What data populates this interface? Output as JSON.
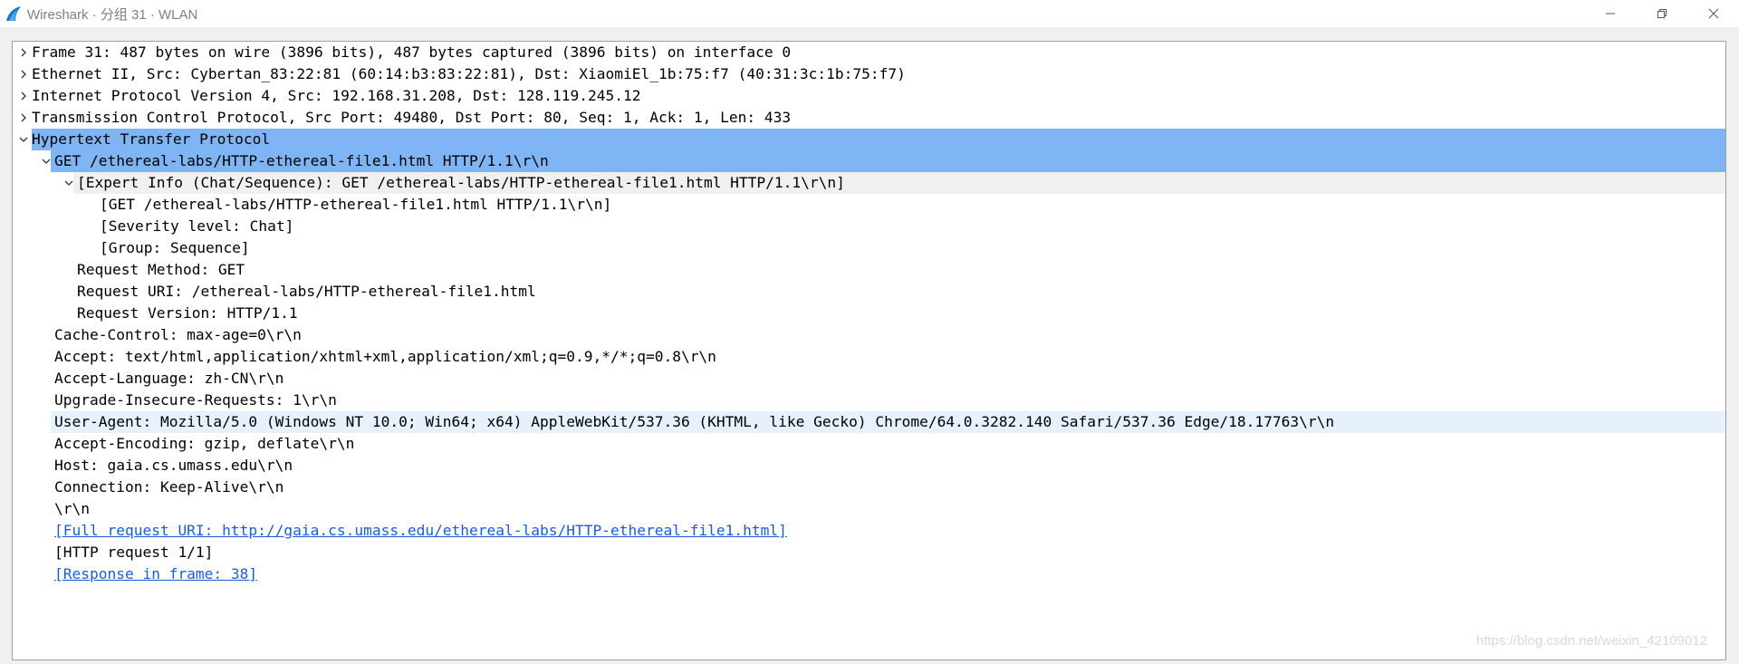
{
  "window": {
    "title": "Wireshark · 分组 31 · WLAN",
    "icon": "wireshark-fin-icon",
    "controls": [
      "minimize-icon",
      "restore-icon",
      "close-icon"
    ]
  },
  "tree": {
    "rows": [
      {
        "text": "Frame 31: 487 bytes on wire (3896 bits), 487 bytes captured (3896 bits) on interface 0",
        "expander": "collapsed",
        "state": ""
      },
      {
        "text": "Ethernet II, Src: Cybertan_83:22:81 (60:14:b3:83:22:81), Dst: XiaomiEl_1b:75:f7 (40:31:3c:1b:75:f7)",
        "expander": "collapsed",
        "state": ""
      },
      {
        "text": "Internet Protocol Version 4, Src: 192.168.31.208, Dst: 128.119.245.12",
        "expander": "collapsed",
        "state": ""
      },
      {
        "text": "Transmission Control Protocol, Src Port: 49480, Dst Port: 80, Seq: 1, Ack: 1, Len: 433",
        "expander": "collapsed",
        "state": ""
      },
      {
        "text": "Hypertext Transfer Protocol",
        "expander": "expanded",
        "state": "selected"
      },
      {
        "text": "GET /ethereal-labs/HTTP-ethereal-file1.html HTTP/1.1\\r\\n",
        "expander": "expanded",
        "state": "selected"
      },
      {
        "text": "[Expert Info (Chat/Sequence): GET /ethereal-labs/HTTP-ethereal-file1.html HTTP/1.1\\r\\n]",
        "expander": "expanded",
        "state": "related"
      },
      {
        "text": "[GET /ethereal-labs/HTTP-ethereal-file1.html HTTP/1.1\\r\\n]",
        "expander": "none",
        "state": ""
      },
      {
        "text": "[Severity level: Chat]",
        "expander": "none",
        "state": ""
      },
      {
        "text": "[Group: Sequence]",
        "expander": "none",
        "state": ""
      },
      {
        "text": "Request Method: GET",
        "expander": "none",
        "state": ""
      },
      {
        "text": "Request URI: /ethereal-labs/HTTP-ethereal-file1.html",
        "expander": "none",
        "state": ""
      },
      {
        "text": "Request Version: HTTP/1.1",
        "expander": "none",
        "state": ""
      },
      {
        "text": "Cache-Control: max-age=0\\r\\n",
        "expander": "none",
        "state": ""
      },
      {
        "text": "Accept: text/html,application/xhtml+xml,application/xml;q=0.9,*/*;q=0.8\\r\\n",
        "expander": "none",
        "state": ""
      },
      {
        "text": "Accept-Language: zh-CN\\r\\n",
        "expander": "none",
        "state": ""
      },
      {
        "text": "Upgrade-Insecure-Requests: 1\\r\\n",
        "expander": "none",
        "state": ""
      },
      {
        "text": "User-Agent: Mozilla/5.0 (Windows NT 10.0; Win64; x64) AppleWebKit/537.36 (KHTML, like Gecko) Chrome/64.0.3282.140 Safari/537.36 Edge/18.17763\\r\\n",
        "expander": "none",
        "state": "hover"
      },
      {
        "text": "Accept-Encoding: gzip, deflate\\r\\n",
        "expander": "none",
        "state": ""
      },
      {
        "text": "Host: gaia.cs.umass.edu\\r\\n",
        "expander": "none",
        "state": ""
      },
      {
        "text": "Connection: Keep-Alive\\r\\n",
        "expander": "none",
        "state": ""
      },
      {
        "text": "\\r\\n",
        "expander": "none",
        "state": ""
      },
      {
        "text": "[Full request URI: http://gaia.cs.umass.edu/ethereal-labs/HTTP-ethereal-file1.html]",
        "expander": "none",
        "state": "",
        "link": true
      },
      {
        "text": "[HTTP request 1/1]",
        "expander": "none",
        "state": ""
      },
      {
        "text": "[Response in frame: 38]",
        "expander": "none",
        "state": "",
        "link": true
      }
    ]
  },
  "watermark": "https://blog.csdn.net/weixin_42109012",
  "colors": {
    "selected": "#80b5f5",
    "related": "#f0f0f0",
    "hover": "#e6f1fc",
    "link": "#1a5cd9"
  }
}
